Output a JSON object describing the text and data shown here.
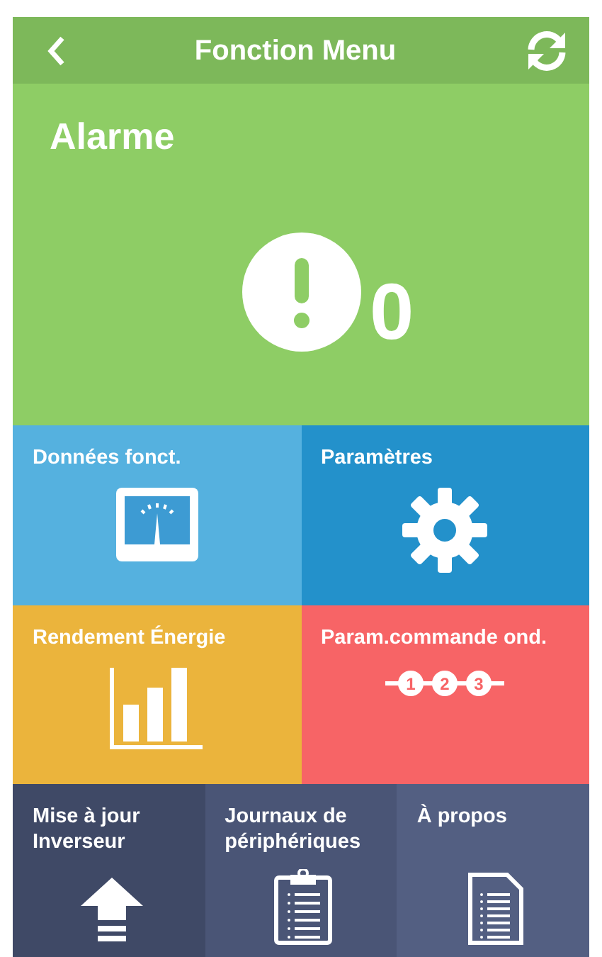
{
  "header": {
    "title": "Fonction Menu"
  },
  "alarm": {
    "title": "Alarme",
    "count": "0"
  },
  "tiles": [
    {
      "label": "Données fonct.",
      "kind": "gauge",
      "color": "#55b1df"
    },
    {
      "label": "Paramètres",
      "kind": "gear",
      "color": "#2391cb"
    },
    {
      "label": "Rendement Énergie",
      "kind": "chart",
      "color": "#ebb43c"
    },
    {
      "label": "Param.commande ond.",
      "kind": "steps",
      "color": "#f76466",
      "steps": [
        "1",
        "2",
        "3"
      ]
    }
  ],
  "bottom_tiles": [
    {
      "label": "Mise à jour Inverseur",
      "kind": "upload",
      "color": "#3f4966"
    },
    {
      "label": "Journaux de périphériques",
      "kind": "clipboard",
      "color": "#4a5576"
    },
    {
      "label": "À propos",
      "kind": "document",
      "color": "#535f82"
    }
  ]
}
